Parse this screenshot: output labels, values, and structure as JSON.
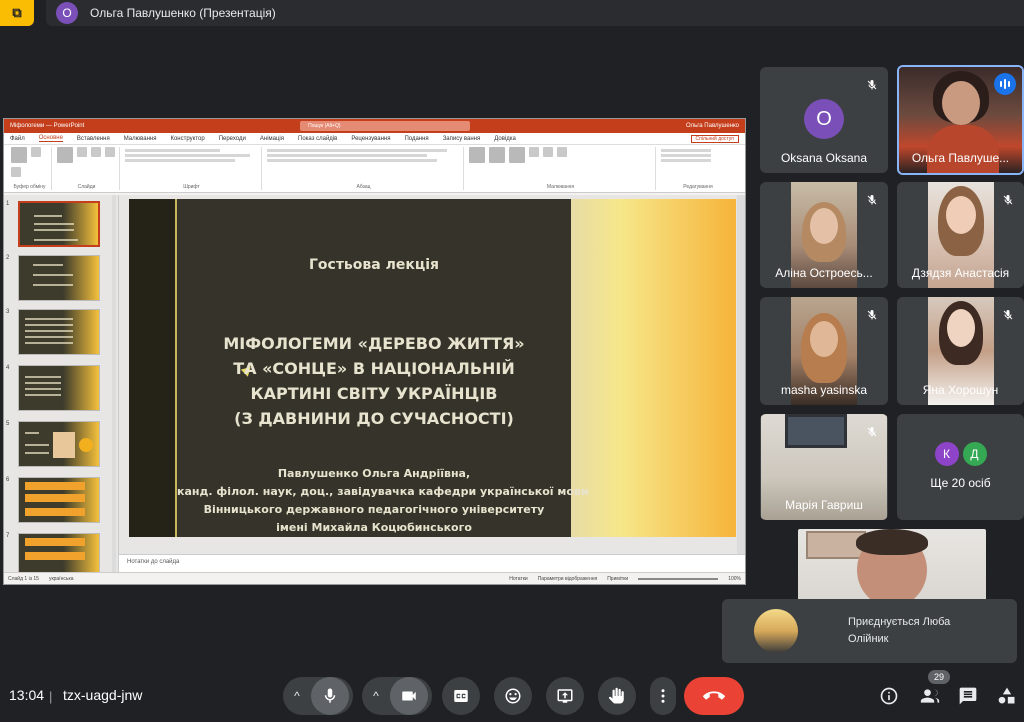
{
  "top_bar": {
    "presenter_initial": "О",
    "presenter_label": "Ольга Павлушенко (Презентація)"
  },
  "powerpoint": {
    "window_title": "Міфологеми — PowerPoint",
    "search_placeholder": "Пошук (Alt+Q)",
    "user_name": "Ольга Павлушенко",
    "tabs": [
      "Файл",
      "Основне",
      "Вставлення",
      "Малювання",
      "Конструктор",
      "Переходи",
      "Анімація",
      "Показ слайдів",
      "Рецензування",
      "Подання",
      "Запису вання",
      "Довідка"
    ],
    "share_label": "Спільний доступ",
    "ribbon_groups": [
      "Буфер обміну",
      "Слайди",
      "Шрифт",
      "Абзац",
      "Малювання",
      "Редагування"
    ],
    "slide_numbers": [
      "1",
      "2",
      "3",
      "4",
      "5",
      "6",
      "7"
    ],
    "slide": {
      "heading": "Гостьова лекція",
      "title_lines": [
        "МІФОЛОГЕМИ «ДЕРЕВО ЖИТТЯ»",
        "ТА «СОНЦЕ» В НАЦІОНАЛЬНІЙ",
        "КАРТИНІ СВІТУ УКРАЇНЦІВ",
        "(З ДАВНИНИ ДО СУЧАСНОСТІ)"
      ],
      "author_lines": [
        "Павлушенко Ольга Андріївна,",
        "канд. філол. наук, доц., завідувачка кафедри української мови",
        "Вінницького державного педагогічного університету",
        "імені Михайла Коцюбинського"
      ]
    },
    "notes_placeholder": "Нотатки до слайда",
    "status_slide": "Слайд 1 із 15",
    "status_lang": "українська",
    "status_notes": "Нотатки",
    "status_display": "Параметри відображення",
    "status_comments": "Примітки",
    "status_zoom": "100%"
  },
  "participants": [
    {
      "name": "Oksana Oksana",
      "initial": "O",
      "muted": true,
      "has_video": false
    },
    {
      "name": "Ольга Павлуше...",
      "muted": false,
      "speaking": true,
      "has_video": true
    },
    {
      "name": "Аліна Остроесь...",
      "muted": true,
      "has_video": true
    },
    {
      "name": "Дзядзя Анастасія",
      "muted": true,
      "has_video": true
    },
    {
      "name": "masha yasinska",
      "muted": true,
      "has_video": true
    },
    {
      "name": "Яна Хорошун",
      "muted": true,
      "has_video": true
    },
    {
      "name": "Марія Гавриш",
      "muted": true,
      "has_video": true
    }
  ],
  "more_tile": {
    "avatars": [
      {
        "initial": "К",
        "color": "#8e44c9"
      },
      {
        "initial": "Д",
        "color": "#34a853"
      }
    ],
    "label": "Ще 20 осіб"
  },
  "toast": {
    "text": "Приєднується Люба Олійник"
  },
  "bottom_bar": {
    "time": "13:04",
    "separator": "|",
    "meeting_code": "tzx-uagd-jnw",
    "people_count": "29"
  },
  "colors": {
    "background": "#202124",
    "tile": "#3c4043",
    "end_call": "#ea4335",
    "active_border": "#8ab4f8",
    "ppt_accent": "#c43e1c"
  }
}
